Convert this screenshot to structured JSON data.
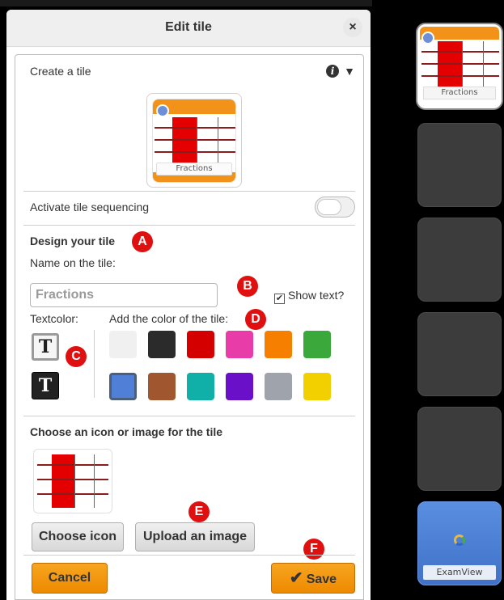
{
  "dialog": {
    "title": "Edit tile",
    "close_label": "×"
  },
  "create": {
    "heading": "Create a tile",
    "info_icon": "i",
    "collapse_icon": "▼",
    "tile_name": "Fractions"
  },
  "sequencing": {
    "label": "Activate tile sequencing",
    "enabled": false
  },
  "design": {
    "heading": "Design your tile",
    "name_label": "Name on the tile:",
    "name_value": "Fractions",
    "show_text_label": "Show text?",
    "show_text_checked": true,
    "textcolor_label": "Textcolor:",
    "tile_color_label": "Add the color of the tile:",
    "textcolor_glyph": "T",
    "colors": [
      "#f0f0f0",
      "#2b2b2b",
      "#d40000",
      "#e83ca8",
      "#f77f00",
      "#3aa83a",
      "#4f7fd6",
      "#a0572f",
      "#10b0a8",
      "#6a10c8",
      "#9fa3ac",
      "#f2d000"
    ],
    "selected_color": "#4f7fd6"
  },
  "icon_section": {
    "heading": "Choose an icon or image for the tile",
    "choose_icon_label": "Choose icon",
    "upload_label": "Upload an image"
  },
  "actions": {
    "cancel_label": "Cancel",
    "save_icon": "✔",
    "save_label": "Save"
  },
  "markers": {
    "a": "A",
    "b": "B",
    "c": "C",
    "d": "D",
    "e": "E",
    "f": "F"
  },
  "sidebar": {
    "first_tile_label": "Fractions",
    "exam_tile_label": "ExamView"
  }
}
